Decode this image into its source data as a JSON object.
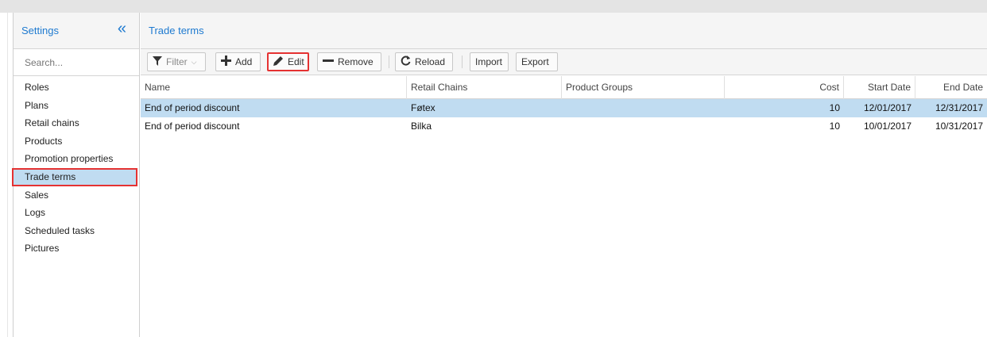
{
  "sidebar": {
    "title": "Settings",
    "collapse_icon": "double-chevron-left-icon",
    "search_placeholder": "Search...",
    "items": [
      {
        "label": "Roles"
      },
      {
        "label": "Plans"
      },
      {
        "label": "Retail chains"
      },
      {
        "label": "Products"
      },
      {
        "label": "Promotion properties"
      },
      {
        "label": "Trade terms",
        "active": true
      },
      {
        "label": "Sales"
      },
      {
        "label": "Logs"
      },
      {
        "label": "Scheduled tasks"
      },
      {
        "label": "Pictures"
      }
    ]
  },
  "main": {
    "title": "Trade terms",
    "toolbar": {
      "filter_label": "Filter",
      "add_label": "Add",
      "edit_label": "Edit",
      "remove_label": "Remove",
      "reload_label": "Reload",
      "import_label": "Import",
      "export_label": "Export"
    },
    "columns": {
      "name": "Name",
      "retail_chains": "Retail Chains",
      "product_groups": "Product Groups",
      "cost": "Cost",
      "start_date": "Start Date",
      "end_date": "End Date"
    },
    "rows": [
      {
        "name": "End of period discount",
        "retail_chains": "Føtex",
        "product_groups": "",
        "cost": "10",
        "start_date": "12/01/2017",
        "end_date": "12/31/2017",
        "selected": true
      },
      {
        "name": "End of period discount",
        "retail_chains": "Bilka",
        "product_groups": "",
        "cost": "10",
        "start_date": "10/01/2017",
        "end_date": "10/31/2017",
        "selected": false
      }
    ]
  },
  "colors": {
    "accent": "#1e7ad0",
    "selection": "#c0dcf1",
    "highlight_border": "#e53232"
  }
}
